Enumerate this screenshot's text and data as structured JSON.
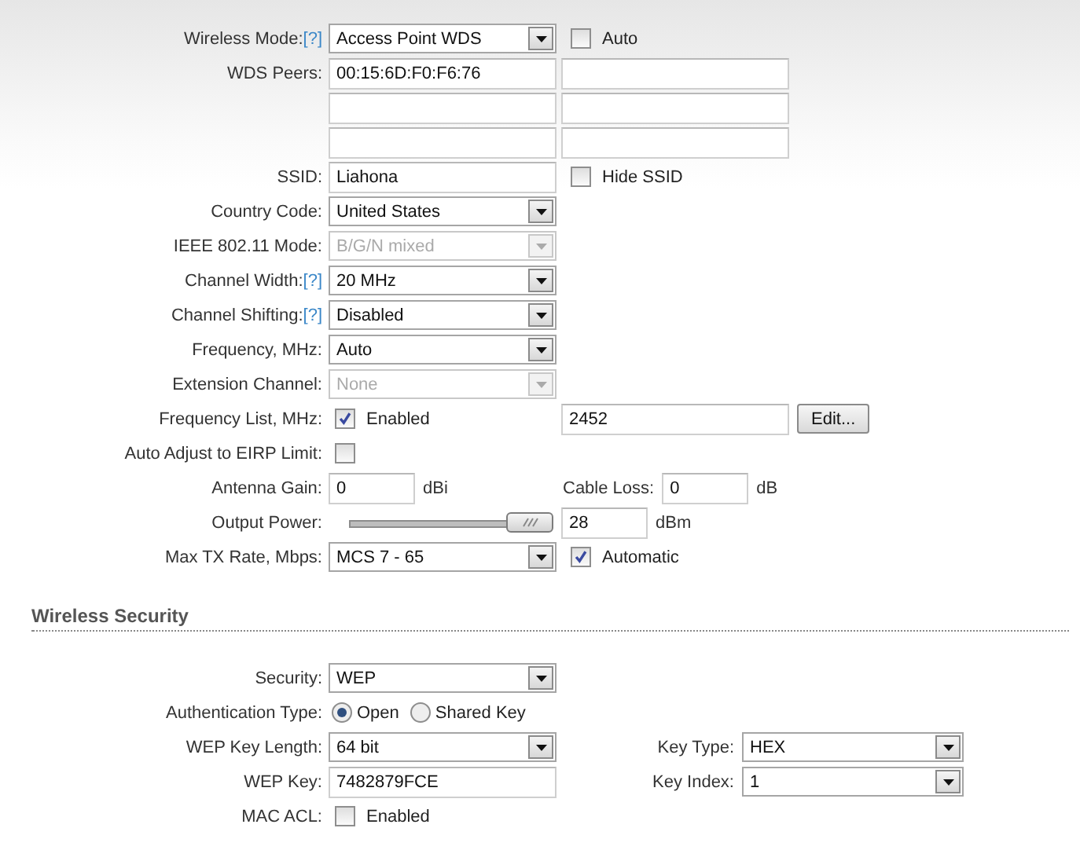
{
  "wireless": {
    "rows": [
      {
        "label": "Wireless Mode:",
        "help": "[?]",
        "cells": [
          [
            {
              "kind": "select",
              "value": "Access Point WDS",
              "disabled": false
            },
            {
              "kind": "checkbox",
              "checked": false,
              "label": "Auto"
            }
          ]
        ]
      },
      {
        "label": "WDS Peers:",
        "cells": [
          [
            {
              "kind": "text",
              "value": "00:15:6D:F0:F6:76"
            }
          ],
          [
            {
              "kind": "text"
            }
          ]
        ]
      },
      {
        "cells": [
          [
            {
              "kind": "text"
            }
          ],
          [
            {
              "kind": "text"
            }
          ]
        ]
      },
      {
        "cells": [
          [
            {
              "kind": "text"
            }
          ],
          [
            {
              "kind": "text"
            }
          ]
        ]
      },
      {
        "label": "SSID:",
        "cells": [
          [
            {
              "kind": "text",
              "value": "Liahona"
            },
            {
              "kind": "checkbox",
              "checked": false,
              "label": "Hide SSID"
            }
          ]
        ]
      },
      {
        "label": "Country Code:",
        "cells": [
          [
            {
              "kind": "select",
              "value": "United States",
              "disabled": false
            }
          ]
        ]
      },
      {
        "label": "IEEE 802.11 Mode:",
        "cells": [
          [
            {
              "kind": "select",
              "value": "B/G/N mixed",
              "disabled": true
            }
          ]
        ]
      },
      {
        "label": "Channel Width:",
        "help": "[?]",
        "cells": [
          [
            {
              "kind": "select",
              "value": "20 MHz",
              "disabled": false
            }
          ]
        ]
      },
      {
        "label": "Channel Shifting:",
        "help": "[?]",
        "cells": [
          [
            {
              "kind": "select",
              "value": "Disabled",
              "disabled": false
            }
          ]
        ]
      },
      {
        "label": "Frequency, MHz:",
        "cells": [
          [
            {
              "kind": "select",
              "value": "Auto",
              "disabled": false
            }
          ]
        ]
      },
      {
        "label": "Extension Channel:",
        "cells": [
          [
            {
              "kind": "select",
              "value": "None",
              "disabled": true
            }
          ]
        ]
      },
      {
        "label": "Frequency List, MHz:",
        "cells": [
          [
            {
              "kind": "checkbox",
              "checked": true,
              "label": "Enabled"
            }
          ],
          [
            {
              "kind": "text",
              "value": "2452"
            },
            {
              "kind": "button",
              "label": "Edit..."
            }
          ]
        ]
      },
      {
        "label": "Auto Adjust to EIRP Limit:",
        "cells": [
          [
            {
              "kind": "checkbox",
              "checked": false
            }
          ]
        ]
      },
      {
        "label": "Antenna Gain:",
        "cells": [
          [
            {
              "kind": "short-text",
              "value": "0"
            },
            {
              "kind": "unit",
              "text": "dBi"
            }
          ],
          [
            {
              "kind": "label",
              "text": "Cable Loss:"
            },
            {
              "kind": "short-text",
              "value": "0"
            },
            {
              "kind": "unit",
              "text": "dB"
            }
          ]
        ]
      },
      {
        "label": "Output Power:",
        "cells": [
          [
            {
              "kind": "slider",
              "level": 1
            }
          ],
          [
            {
              "kind": "short-text",
              "value": "28"
            },
            {
              "kind": "unit",
              "text": "dBm"
            }
          ]
        ]
      },
      {
        "label": "Max TX Rate, Mbps:",
        "cells": [
          [
            {
              "kind": "select",
              "value": "MCS 7 - 65",
              "disabled": false
            },
            {
              "kind": "checkbox",
              "checked": true,
              "label": "Automatic"
            }
          ]
        ]
      }
    ]
  },
  "security": {
    "heading": "Wireless Security",
    "rows": [
      {
        "label": "Security:",
        "cells": [
          [
            {
              "kind": "select",
              "value": "WEP",
              "disabled": false
            }
          ]
        ]
      },
      {
        "label": "Authentication Type:",
        "cells": [
          [
            {
              "kind": "radio",
              "selected": true,
              "label": "Open"
            },
            {
              "kind": "radio",
              "selected": false,
              "label": "Shared Key"
            }
          ]
        ]
      },
      {
        "label": "WEP Key Length:",
        "cells": [
          [
            {
              "kind": "select",
              "value": "64 bit",
              "disabled": false
            }
          ],
          [
            {
              "kind": "side-label",
              "text": "Key Type:"
            },
            {
              "kind": "select",
              "value": "HEX",
              "disabled": false
            }
          ]
        ]
      },
      {
        "label": "WEP Key:",
        "cells": [
          [
            {
              "kind": "text",
              "value": "7482879FCE"
            }
          ],
          [
            {
              "kind": "side-label",
              "text": "Key Index:"
            },
            {
              "kind": "select",
              "value": "1",
              "disabled": false
            }
          ]
        ]
      },
      {
        "label": "MAC ACL:",
        "cells": [
          [
            {
              "kind": "checkbox",
              "checked": false,
              "label": "Enabled"
            }
          ]
        ]
      }
    ]
  }
}
